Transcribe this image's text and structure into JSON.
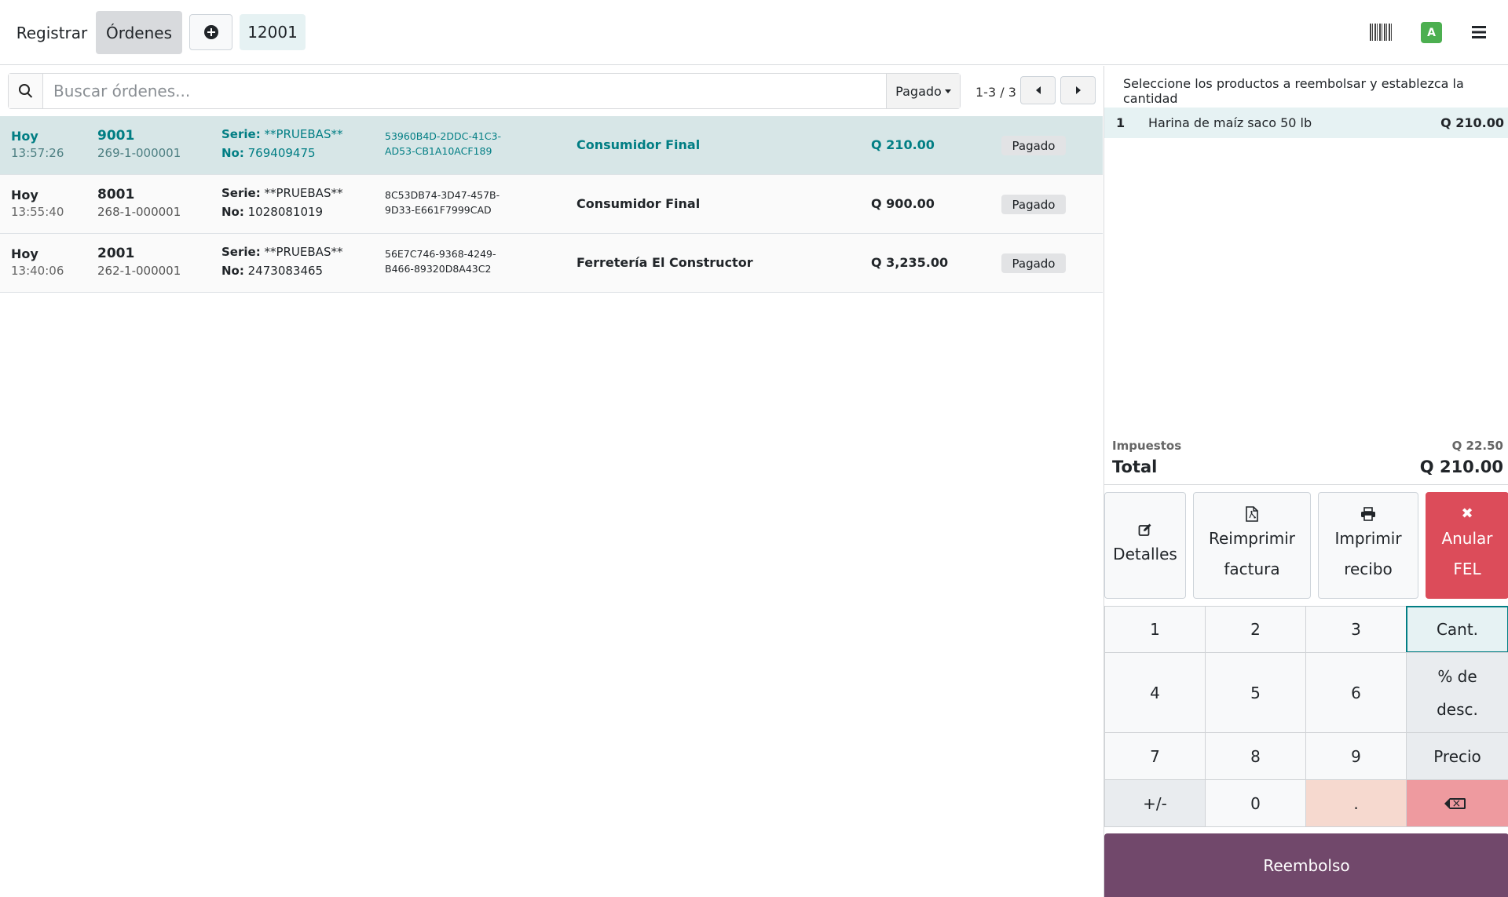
{
  "header": {
    "nav_registrar": "Registrar",
    "nav_ordenes": "Órdenes",
    "order_tag": "12001",
    "avatar_initial": "A"
  },
  "search": {
    "placeholder": "Buscar órdenes...",
    "value": "",
    "filter_label": "Pagado",
    "pager": "1-3 / 3"
  },
  "orders": [
    {
      "date": "Hoy",
      "time": "13:57:26",
      "number": "9001",
      "reference": "269-1-000001",
      "serie_label": "Serie:",
      "serie": "**PRUEBAS**",
      "no_label": "No:",
      "no": "769409475",
      "uuid_line1": "53960B4D-2DDC-41C3-",
      "uuid_line2": "AD53-CB1A10ACF189",
      "client": "Consumidor Final",
      "amount": "Q 210.00",
      "status": "Pagado",
      "selected": true
    },
    {
      "date": "Hoy",
      "time": "13:55:40",
      "number": "8001",
      "reference": "268-1-000001",
      "serie_label": "Serie:",
      "serie": "**PRUEBAS**",
      "no_label": "No:",
      "no": "1028081019",
      "uuid_line1": "8C53DB74-3D47-457B-",
      "uuid_line2": "9D33-E661F7999CAD",
      "client": "Consumidor Final",
      "amount": "Q 900.00",
      "status": "Pagado",
      "selected": false
    },
    {
      "date": "Hoy",
      "time": "13:40:06",
      "number": "2001",
      "reference": "262-1-000001",
      "serie_label": "Serie:",
      "serie": "**PRUEBAS**",
      "no_label": "No:",
      "no": "2473083465",
      "uuid_line1": "56E7C746-9368-4249-",
      "uuid_line2": "B466-89320D8A43C2",
      "client": "Ferretería El Constructor",
      "amount": "Q 3,235.00",
      "status": "Pagado",
      "selected": false
    }
  ],
  "refund": {
    "hint": "Seleccione los productos a reembolsar y establezca la cantidad",
    "line": {
      "qty": "1",
      "product": "Harina de maíz saco 50 lb",
      "price": "Q 210.00"
    },
    "tax_label": "Impuestos",
    "tax_value": "Q 22.50",
    "total_label": "Total",
    "total_value": "Q 210.00"
  },
  "actions": {
    "details_label": "Detalles",
    "reprint_line1": "Reimprimir",
    "reprint_line2": "factura",
    "print_line1": "Imprimir",
    "print_line2": "recibo",
    "void_line1": "Anular",
    "void_line2": "FEL",
    "void_icon": "✖",
    "print_icon": "🖶"
  },
  "numpad": {
    "k1": "1",
    "k2": "2",
    "k3": "3",
    "qty": "Cant.",
    "k4": "4",
    "k5": "5",
    "k6": "6",
    "disc_line1": "% de",
    "disc_line2": "desc.",
    "k7": "7",
    "k8": "8",
    "k9": "9",
    "price": "Precio",
    "sign": "+/-",
    "k0": "0",
    "dot": "."
  },
  "refund_button": "Reembolso",
  "colors": {
    "accent": "#017e84",
    "void": "#dc4c5a",
    "refund": "#71486b",
    "avatar": "#4caf50"
  }
}
